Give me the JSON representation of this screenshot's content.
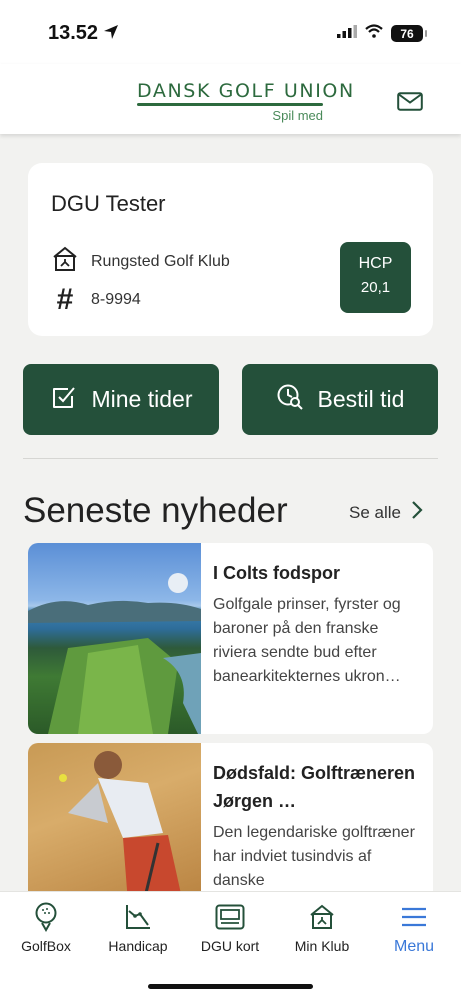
{
  "status_bar": {
    "time": "13.52",
    "battery": "76"
  },
  "header": {
    "logo_main": "DANSK GOLF UNION",
    "logo_sub": "Spil med"
  },
  "profile": {
    "name": "DGU Tester",
    "club": "Rungsted Golf Klub",
    "member_id": "8-9994",
    "hcp_label": "HCP",
    "hcp_value": "20,1"
  },
  "actions": {
    "my_times": "Mine tider",
    "book_time": "Bestil tid"
  },
  "news": {
    "section_title": "Seneste nyheder",
    "see_all": "Se alle",
    "items": [
      {
        "title": "I Colts fodspor",
        "excerpt": "Golfgale prinser, fyrster og baroner på den franske riviera sendte bud efter banearkitekternes ukron…"
      },
      {
        "title": "Dødsfald: Golftræneren Jørgen …",
        "excerpt": "Den legendariske golftræner har indviet tusindvis af danske"
      }
    ]
  },
  "tabs": [
    {
      "label": "GolfBox",
      "icon": "golf-ball-icon"
    },
    {
      "label": "Handicap",
      "icon": "chart-icon"
    },
    {
      "label": "DGU kort",
      "icon": "card-icon"
    },
    {
      "label": "Min Klub",
      "icon": "clubhouse-icon"
    },
    {
      "label": "Menu",
      "icon": "menu-icon"
    }
  ],
  "colors": {
    "primary": "#24503a",
    "active_tab": "#3a78d8",
    "background": "#f2f2f0"
  }
}
